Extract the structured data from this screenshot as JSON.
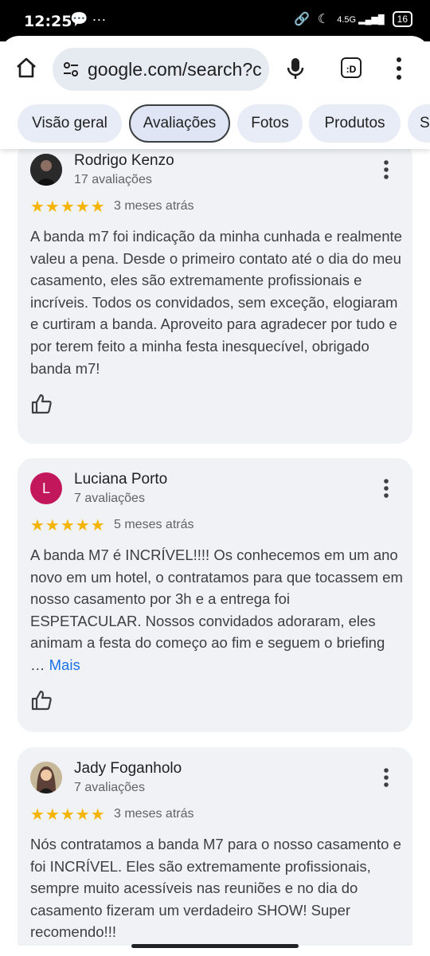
{
  "status": {
    "time": "12:25",
    "network": "4.5G",
    "battery": "16"
  },
  "browser": {
    "url": "google.com/search?c",
    "tabs_label": ":D"
  },
  "filters": [
    "Visão geral",
    "Avaliações",
    "Fotos",
    "Produtos",
    "Se"
  ],
  "reviews": [
    {
      "name": "Rodrigo Kenzo",
      "count": "17 avaliações",
      "stars": "★★★★★",
      "date": "3 meses atrás",
      "text": "A banda m7 foi indicação da minha cunhada e realmente valeu a pena. Desde o primeiro contato até o dia do meu casamento, eles são extremamente profissionais e incríveis. Todos os convidados, sem exceção, elogiaram e curtiram a banda. Aproveito para agradecer por tudo e por terem feito a minha festa inesquecível, obrigado banda m7!"
    },
    {
      "name": "Luciana Porto",
      "count": "7 avaliações",
      "stars": "★★★★★",
      "date": "5 meses atrás",
      "avatar_letter": "L",
      "text": "A banda M7 é INCRÍVEL!!!! Os conhecemos em um ano novo em um hotel, o contratamos para que tocassem em nosso casamento por 3h e a entrega foi ESPETACULAR. Nossos convidados adoraram, eles animam a festa do começo ao fim e seguem o briefing",
      "more_prefix": "… ",
      "more": "Mais"
    },
    {
      "name": "Jady Foganholo",
      "count": "7 avaliações",
      "stars": "★★★★★",
      "date": "3 meses atrás",
      "text": "Nós contratamos a banda M7 para o nosso casamento e foi INCRÍVEL. Eles são extremamente profissionais, sempre muito acessíveis nas reuniões e no dia do casamento fizeram um verdadeiro SHOW! Super recomendo!!!"
    }
  ],
  "colors": {
    "star": "#f5b400",
    "link": "#1a73e8",
    "card": "#f0f2f5",
    "avatar_l": "#c2185b"
  }
}
